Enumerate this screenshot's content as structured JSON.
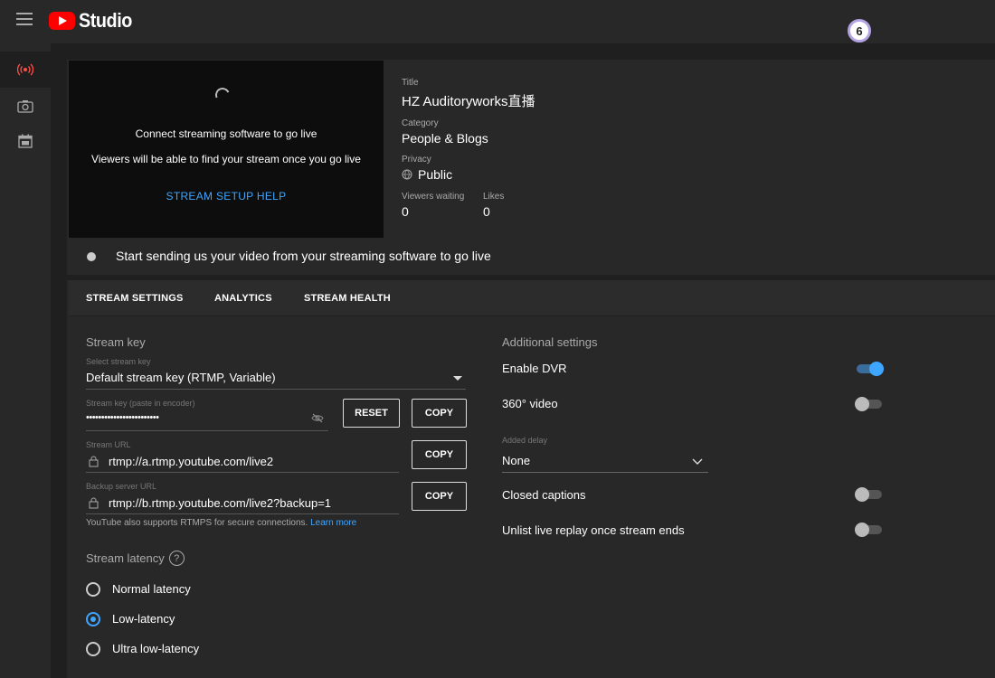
{
  "app": {
    "brand": "Studio",
    "notification_count": "6"
  },
  "sidebar": {
    "items": [
      {
        "icon": "live-broadcast-icon",
        "active": true
      },
      {
        "icon": "camera-icon",
        "active": false
      },
      {
        "icon": "calendar-icon",
        "active": false
      }
    ]
  },
  "preview": {
    "line1": "Connect streaming software to go live",
    "line2": "Viewers will be able to find your stream once you go live",
    "help_link": "STREAM SETUP HELP"
  },
  "info": {
    "title_label": "Title",
    "title_value": "HZ Auditoryworks直播",
    "category_label": "Category",
    "category_value": "People & Blogs",
    "privacy_label": "Privacy",
    "privacy_value": "Public",
    "viewers_label": "Viewers waiting",
    "viewers_value": "0",
    "likes_label": "Likes",
    "likes_value": "0"
  },
  "status_text": "Start sending us your video from your streaming software to go live",
  "tabs": [
    "STREAM SETTINGS",
    "ANALYTICS",
    "STREAM HEALTH"
  ],
  "stream_key": {
    "section_title": "Stream key",
    "select_label": "Select stream key",
    "select_value": "Default stream key (RTMP, Variable)",
    "key_label": "Stream key (paste in encoder)",
    "key_value": "••••••••••••••••••••••••",
    "reset_label": "RESET",
    "copy_label": "COPY",
    "url_label": "Stream URL",
    "url_value": "rtmp://a.rtmp.youtube.com/live2",
    "backup_label": "Backup server URL",
    "backup_value": "rtmp://b.rtmp.youtube.com/live2?backup=1",
    "rtmps_note": "YouTube also supports RTMPS for secure connections.",
    "learn_more": "Learn more"
  },
  "latency": {
    "title": "Stream latency",
    "help": "?",
    "options": [
      "Normal latency",
      "Low-latency",
      "Ultra low-latency"
    ],
    "selected": "Low-latency"
  },
  "additional": {
    "title": "Additional settings",
    "enable_dvr": "Enable DVR",
    "dvr_on": true,
    "video_360": "360° video",
    "video_360_on": false,
    "delay_label": "Added delay",
    "delay_value": "None",
    "closed_captions": "Closed captions",
    "cc_on": false,
    "unlist_replay": "Unlist live replay once stream ends",
    "unlist_on": false
  },
  "colors": {
    "accent": "#3ea6ff",
    "brand_red": "#ff0000",
    "bg": "#282828"
  }
}
